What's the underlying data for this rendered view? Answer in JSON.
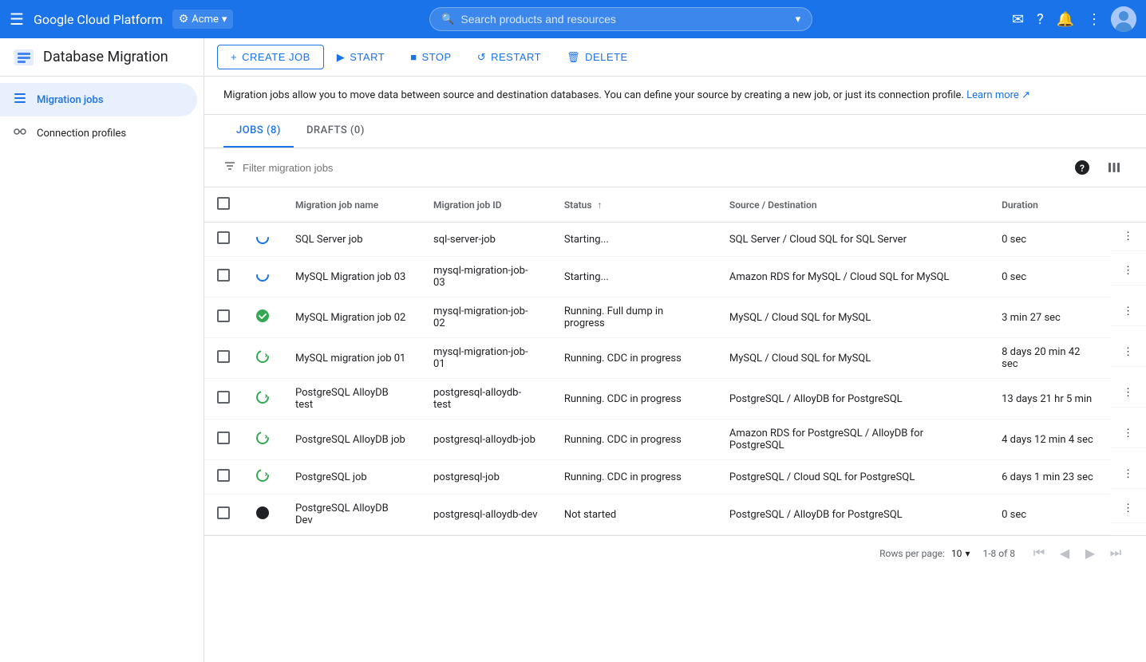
{
  "topNav": {
    "hamburger": "☰",
    "brand": "Google Cloud Platform",
    "project": "Acme",
    "search_placeholder": "Search products and resources",
    "icons": [
      "email-icon",
      "help-icon",
      "notifications-icon",
      "more-vert-icon"
    ]
  },
  "appHeader": {
    "title": "Database Migration",
    "actions": [
      {
        "key": "create_job",
        "label": "CREATE JOB",
        "icon": "+"
      },
      {
        "key": "start",
        "label": "START",
        "icon": "▶"
      },
      {
        "key": "stop",
        "label": "STOP",
        "icon": "■"
      },
      {
        "key": "restart",
        "label": "RESTART",
        "icon": "↺"
      },
      {
        "key": "delete",
        "label": "DELETE",
        "icon": "🗑"
      }
    ]
  },
  "sidebar": {
    "items": [
      {
        "key": "migration_jobs",
        "label": "Migration jobs",
        "icon": "list",
        "active": true
      },
      {
        "key": "connection_profiles",
        "label": "Connection profiles",
        "icon": "link",
        "active": false
      }
    ]
  },
  "infoBanner": {
    "text": "Migration jobs allow you to move data between source and destination databases. You can define your source by creating a new job, or just its connection profile.",
    "learn_more": "Learn more",
    "learn_more_icon": "↗"
  },
  "tabs": [
    {
      "key": "jobs",
      "label": "JOBS (8)",
      "active": true
    },
    {
      "key": "drafts",
      "label": "DRAFTS (0)",
      "active": false
    }
  ],
  "tableToolbar": {
    "filter_placeholder": "Filter migration jobs",
    "help_icon": "?",
    "columns_icon": "|||"
  },
  "table": {
    "columns": [
      {
        "key": "checkbox",
        "label": ""
      },
      {
        "key": "status_icon",
        "label": ""
      },
      {
        "key": "name",
        "label": "Migration job name"
      },
      {
        "key": "id",
        "label": "Migration job ID"
      },
      {
        "key": "status",
        "label": "Status",
        "sortable": true
      },
      {
        "key": "source_dest",
        "label": "Source / Destination"
      },
      {
        "key": "duration",
        "label": "Duration"
      },
      {
        "key": "actions",
        "label": ""
      }
    ],
    "rows": [
      {
        "name": "SQL Server job",
        "id": "sql-server-job",
        "status": "Starting...",
        "status_type": "starting",
        "source_dest": "SQL Server / Cloud SQL for SQL Server",
        "duration": "0 sec"
      },
      {
        "name": "MySQL Migration job 03",
        "id": "mysql-migration-job-03",
        "status": "Starting...",
        "status_type": "starting",
        "source_dest": "Amazon RDS for MySQL / Cloud SQL for MySQL",
        "duration": "0 sec"
      },
      {
        "name": "MySQL Migration job 02",
        "id": "mysql-migration-job-02",
        "status": "Running. Full dump in progress",
        "status_type": "running_full",
        "source_dest": "MySQL / Cloud SQL for MySQL",
        "duration": "3 min 27 sec"
      },
      {
        "name": "MySQL migration job 01",
        "id": "mysql-migration-job-01",
        "status": "Running. CDC in progress",
        "status_type": "running_cdc",
        "source_dest": "MySQL / Cloud SQL for MySQL",
        "duration": "8 days 20 min 42 sec"
      },
      {
        "name": "PostgreSQL AlloyDB test",
        "id": "postgresql-alloydb-test",
        "status": "Running. CDC in progress",
        "status_type": "running_cdc",
        "source_dest": "PostgreSQL / AlloyDB for PostgreSQL",
        "duration": "13 days 21 hr 5 min"
      },
      {
        "name": "PostgreSQL AlloyDB job",
        "id": "postgresql-alloydb-job",
        "status": "Running. CDC in progress",
        "status_type": "running_cdc",
        "source_dest": "Amazon RDS for PostgreSQL / AlloyDB for PostgreSQL",
        "duration": "4 days 12 min 4 sec"
      },
      {
        "name": "PostgreSQL job",
        "id": "postgresql-job",
        "status": "Running. CDC in progress",
        "status_type": "running_cdc",
        "source_dest": "PostgreSQL / Cloud SQL for PostgreSQL",
        "duration": "6 days 1 min 23 sec"
      },
      {
        "name": "PostgreSQL AlloyDB Dev",
        "id": "postgresql-alloydb-dev",
        "status": "Not started",
        "status_type": "not_started",
        "source_dest": "PostgreSQL / AlloyDB for PostgreSQL",
        "duration": "0 sec"
      }
    ]
  },
  "pagination": {
    "rows_per_page_label": "Rows per page:",
    "rows_per_page_value": "10",
    "range": "1-8 of 8"
  }
}
